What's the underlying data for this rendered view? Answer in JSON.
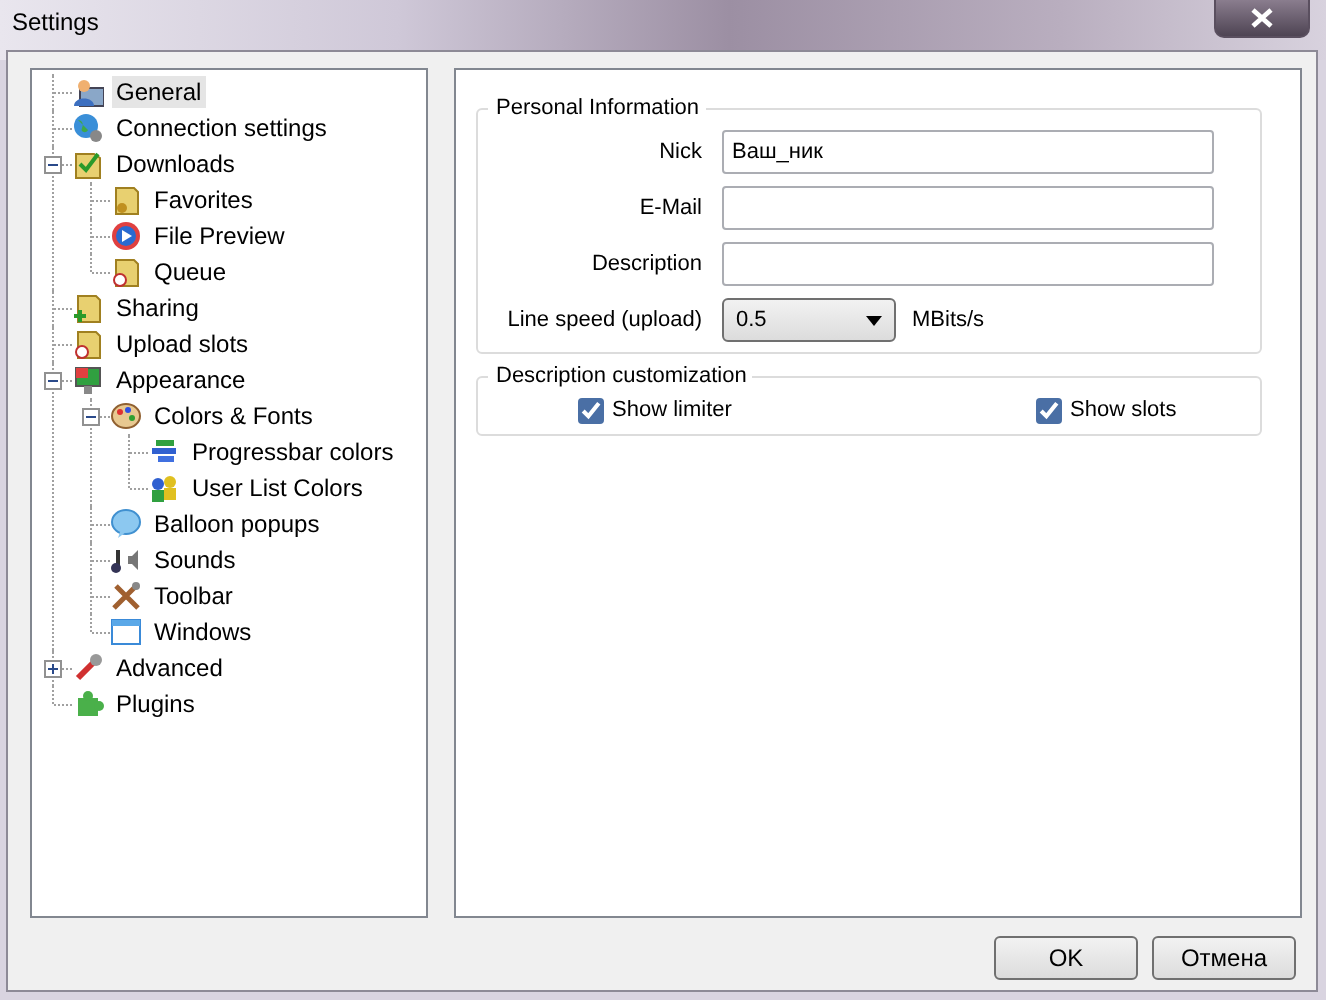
{
  "window": {
    "title": "Settings"
  },
  "tree": [
    {
      "label": "General",
      "selected": true
    },
    {
      "label": "Connection settings",
      "selected": false
    },
    {
      "label": "Downloads",
      "selected": false,
      "expanded": true,
      "children": [
        {
          "label": "Favorites",
          "selected": false
        },
        {
          "label": "File Preview",
          "selected": false
        },
        {
          "label": "Queue",
          "selected": false
        }
      ]
    },
    {
      "label": "Sharing",
      "selected": false
    },
    {
      "label": "Upload slots",
      "selected": false
    },
    {
      "label": "Appearance",
      "selected": false,
      "expanded": true,
      "children": [
        {
          "label": "Colors & Fonts",
          "selected": false,
          "expanded": true,
          "children": [
            {
              "label": "Progressbar colors",
              "selected": false
            },
            {
              "label": "User List Colors",
              "selected": false
            }
          ]
        },
        {
          "label": "Balloon popups",
          "selected": false
        },
        {
          "label": "Sounds",
          "selected": false
        },
        {
          "label": "Toolbar",
          "selected": false
        },
        {
          "label": "Windows",
          "selected": false
        }
      ]
    },
    {
      "label": "Advanced",
      "selected": false,
      "expanded": false
    },
    {
      "label": "Plugins",
      "selected": false
    }
  ],
  "personal_information": {
    "title": "Personal Information",
    "fields": [
      {
        "label": "Nick",
        "value": "Ваш_ник"
      },
      {
        "label": "E-Mail"
      },
      {
        "label": "Description"
      }
    ],
    "line_speed": {
      "label": "Line speed (upload)",
      "value": "0.5",
      "unit": "MBits/s"
    }
  },
  "description_customization": {
    "title": "Description customization",
    "checkboxes": [
      {
        "label": "Show limiter",
        "checked": true
      },
      {
        "label": "Show slots",
        "checked": true
      }
    ]
  },
  "buttons": [
    {
      "label": "OK"
    },
    {
      "label": "Отмена"
    }
  ]
}
